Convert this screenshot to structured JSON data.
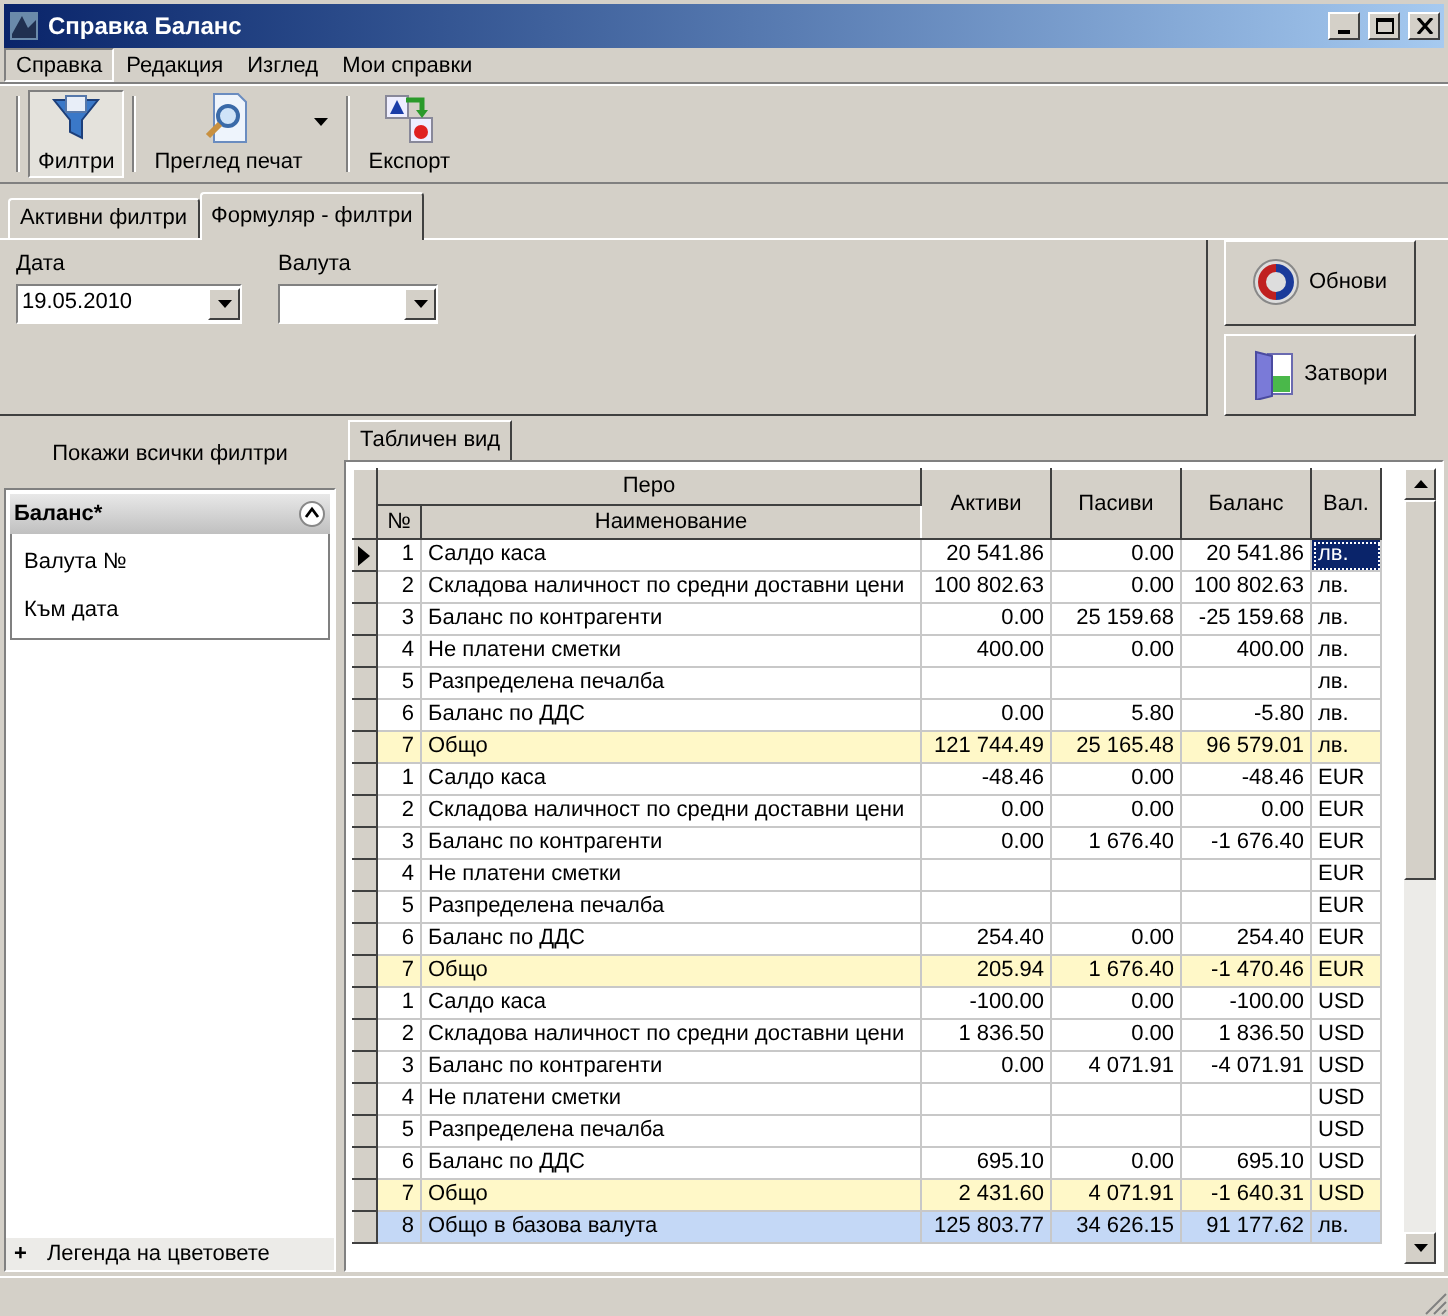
{
  "window": {
    "title": "Справка Баланс"
  },
  "menu": [
    {
      "label": "Справка",
      "selected": true
    },
    {
      "label": "Редакция",
      "selected": false
    },
    {
      "label": "Изглед",
      "selected": false
    },
    {
      "label": "Мои справки",
      "selected": false
    }
  ],
  "toolbar": [
    {
      "kind": "filter",
      "label": "Филтри",
      "pressed": true,
      "dropdown": false
    },
    {
      "kind": "preview",
      "label": "Преглед печат",
      "pressed": false,
      "dropdown": true
    },
    {
      "kind": "export",
      "label": "Експорт",
      "pressed": false,
      "dropdown": false
    }
  ],
  "filter_tabs": [
    {
      "label": "Активни филтри",
      "selected": false
    },
    {
      "label": "Формуляр - филтри",
      "selected": true
    }
  ],
  "fields": [
    {
      "label": "Дата",
      "value": "19.05.2010"
    },
    {
      "label": "Валута"
    }
  ],
  "actions": [
    {
      "kind": "refresh",
      "label": "Обнови"
    },
    {
      "kind": "close",
      "label": "Затвори"
    }
  ],
  "sidebar": {
    "show_all": "Покажи всички филтри",
    "group": {
      "title": "Баланс*",
      "expanded": true,
      "items": [
        "Валута №",
        "Към дата"
      ]
    },
    "legend": {
      "sign": "+",
      "label": "Легенда на цветовете"
    }
  },
  "view_tab": {
    "label": "Табличен вид",
    "selected": true
  },
  "table": {
    "group_header": "Перо",
    "columns": [
      "№",
      "Наименование",
      "Активи",
      "Пасиви",
      "Баланс",
      "Вал."
    ],
    "rows": [
      {
        "kind": "item",
        "selected": true,
        "cells": [
          "1",
          "Салдо каса",
          "20 541.86",
          "0.00",
          "20 541.86",
          "лв."
        ]
      },
      {
        "kind": "item",
        "selected": false,
        "cells": [
          "2",
          "Складова наличност по средни доставни цени",
          "100 802.63",
          "0.00",
          "100 802.63",
          "лв."
        ]
      },
      {
        "kind": "item",
        "selected": false,
        "cells": [
          "3",
          "Баланс по контрагенти",
          "0.00",
          "25 159.68",
          "-25 159.68",
          "лв."
        ]
      },
      {
        "kind": "item",
        "selected": false,
        "cells": [
          "4",
          "Не платени сметки",
          "400.00",
          "0.00",
          "400.00",
          "лв."
        ]
      },
      {
        "kind": "item",
        "selected": false,
        "cells": [
          "5",
          "Разпределена печалба",
          "",
          "",
          "",
          "лв."
        ]
      },
      {
        "kind": "item",
        "selected": false,
        "cells": [
          "6",
          "Баланс по ДДС",
          "0.00",
          "5.80",
          "-5.80",
          "лв."
        ]
      },
      {
        "kind": "subtotal",
        "selected": false,
        "cells": [
          "7",
          "Общо",
          "121 744.49",
          "25 165.48",
          "96 579.01",
          "лв."
        ]
      },
      {
        "kind": "item",
        "selected": false,
        "cells": [
          "1",
          "Салдо каса",
          "-48.46",
          "0.00",
          "-48.46",
          "EUR"
        ]
      },
      {
        "kind": "item",
        "selected": false,
        "cells": [
          "2",
          "Складова наличност по средни доставни цени",
          "0.00",
          "0.00",
          "0.00",
          "EUR"
        ]
      },
      {
        "kind": "item",
        "selected": false,
        "cells": [
          "3",
          "Баланс по контрагенти",
          "0.00",
          "1 676.40",
          "-1 676.40",
          "EUR"
        ]
      },
      {
        "kind": "item",
        "selected": false,
        "cells": [
          "4",
          "Не платени сметки",
          "",
          "",
          "",
          "EUR"
        ]
      },
      {
        "kind": "item",
        "selected": false,
        "cells": [
          "5",
          "Разпределена печалба",
          "",
          "",
          "",
          "EUR"
        ]
      },
      {
        "kind": "item",
        "selected": false,
        "cells": [
          "6",
          "Баланс по ДДС",
          "254.40",
          "0.00",
          "254.40",
          "EUR"
        ]
      },
      {
        "kind": "subtotal",
        "selected": false,
        "cells": [
          "7",
          "Общо",
          "205.94",
          "1 676.40",
          "-1 470.46",
          "EUR"
        ]
      },
      {
        "kind": "item",
        "selected": false,
        "cells": [
          "1",
          "Салдо каса",
          "-100.00",
          "0.00",
          "-100.00",
          "USD"
        ]
      },
      {
        "kind": "item",
        "selected": false,
        "cells": [
          "2",
          "Складова наличност по средни доставни цени",
          "1 836.50",
          "0.00",
          "1 836.50",
          "USD"
        ]
      },
      {
        "kind": "item",
        "selected": false,
        "cells": [
          "3",
          "Баланс по контрагенти",
          "0.00",
          "4 071.91",
          "-4 071.91",
          "USD"
        ]
      },
      {
        "kind": "item",
        "selected": false,
        "cells": [
          "4",
          "Не платени сметки",
          "",
          "",
          "",
          "USD"
        ]
      },
      {
        "kind": "item",
        "selected": false,
        "cells": [
          "5",
          "Разпределена печалба",
          "",
          "",
          "",
          "USD"
        ]
      },
      {
        "kind": "item",
        "selected": false,
        "cells": [
          "6",
          "Баланс по ДДС",
          "695.10",
          "0.00",
          "695.10",
          "USD"
        ]
      },
      {
        "kind": "subtotal",
        "selected": false,
        "cells": [
          "7",
          "Общо",
          "2 431.60",
          "4 071.91",
          "-1 640.31",
          "USD"
        ]
      },
      {
        "kind": "total",
        "selected": false,
        "cells": [
          "8",
          "Общо в базова валута",
          "125 803.77",
          "34 626.15",
          "91 177.62",
          "лв."
        ]
      }
    ]
  }
}
